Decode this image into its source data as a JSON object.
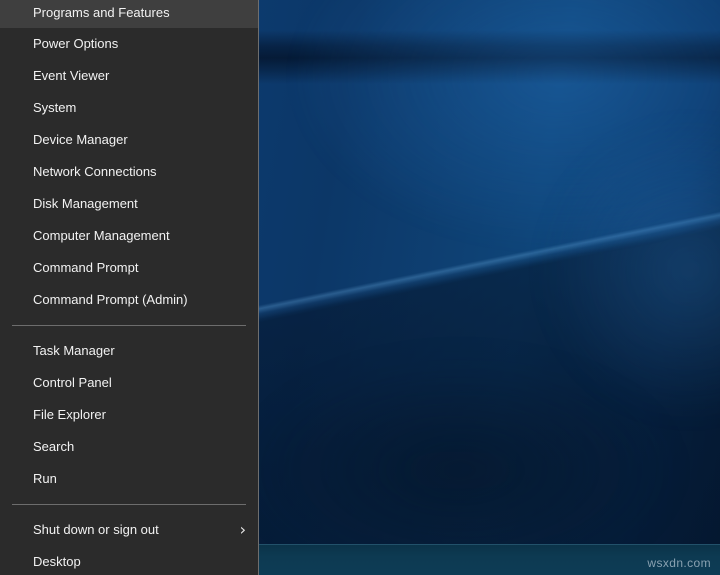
{
  "desktop": {
    "wallpaper_name": "windows-10-hero-blue",
    "colors": {
      "wallpaper_top": "#0e4277",
      "wallpaper_bottom": "#051628",
      "taskbar": "#0d3a52",
      "menu_background": "#2b2b2b",
      "menu_border": "#6e6e6e",
      "menu_text": "#f2f2f2",
      "separator": "#6d6d6d",
      "taskbar_icon": "#a0558f"
    }
  },
  "watermark": {
    "text": "wsxdn.com"
  },
  "taskbar": {
    "pinned": [
      {
        "name": "taskbar-pinned-icon",
        "label": ""
      }
    ]
  },
  "winx_menu": {
    "name": "Win+X Power User Menu",
    "groups": [
      {
        "id": "group-system-tools",
        "items": [
          {
            "id": "programs-and-features",
            "label": "Programs and Features",
            "submenu": false
          },
          {
            "id": "power-options",
            "label": "Power Options",
            "submenu": false
          },
          {
            "id": "event-viewer",
            "label": "Event Viewer",
            "submenu": false
          },
          {
            "id": "system",
            "label": "System",
            "submenu": false
          },
          {
            "id": "device-manager",
            "label": "Device Manager",
            "submenu": false
          },
          {
            "id": "network-connections",
            "label": "Network Connections",
            "submenu": false
          },
          {
            "id": "disk-management",
            "label": "Disk Management",
            "submenu": false
          },
          {
            "id": "computer-management",
            "label": "Computer Management",
            "submenu": false
          },
          {
            "id": "command-prompt",
            "label": "Command Prompt",
            "submenu": false
          },
          {
            "id": "command-prompt-admin",
            "label": "Command Prompt (Admin)",
            "submenu": false
          }
        ]
      },
      {
        "id": "group-shell-tools",
        "items": [
          {
            "id": "task-manager",
            "label": "Task Manager",
            "submenu": false
          },
          {
            "id": "control-panel",
            "label": "Control Panel",
            "submenu": false
          },
          {
            "id": "file-explorer",
            "label": "File Explorer",
            "submenu": false
          },
          {
            "id": "search",
            "label": "Search",
            "submenu": false
          },
          {
            "id": "run",
            "label": "Run",
            "submenu": false
          }
        ]
      },
      {
        "id": "group-session",
        "items": [
          {
            "id": "shut-down-or-sign-out",
            "label": "Shut down or sign out",
            "submenu": true,
            "submenu_glyph": "›"
          },
          {
            "id": "desktop",
            "label": "Desktop",
            "submenu": false
          }
        ]
      }
    ]
  }
}
